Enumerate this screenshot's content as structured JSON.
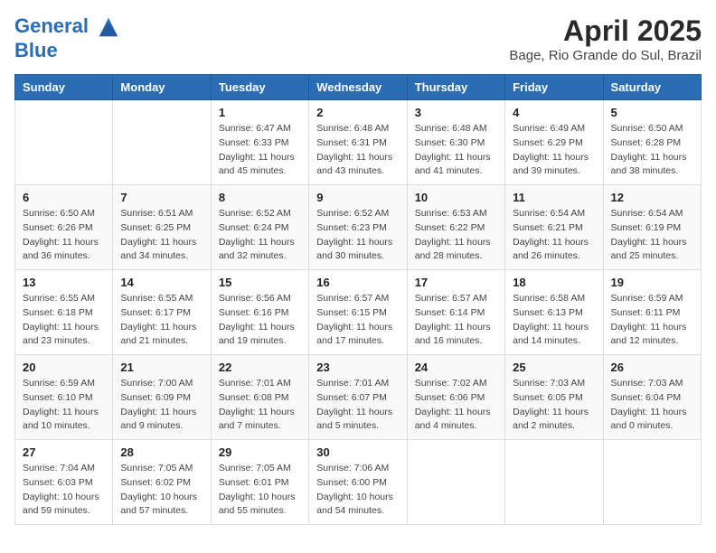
{
  "logo": {
    "line1": "General",
    "line2": "Blue"
  },
  "title": "April 2025",
  "subtitle": "Bage, Rio Grande do Sul, Brazil",
  "days_of_week": [
    "Sunday",
    "Monday",
    "Tuesday",
    "Wednesday",
    "Thursday",
    "Friday",
    "Saturday"
  ],
  "weeks": [
    [
      {
        "day": "",
        "info": ""
      },
      {
        "day": "",
        "info": ""
      },
      {
        "day": "1",
        "sunrise": "6:47 AM",
        "sunset": "6:33 PM",
        "daylight": "11 hours and 45 minutes."
      },
      {
        "day": "2",
        "sunrise": "6:48 AM",
        "sunset": "6:31 PM",
        "daylight": "11 hours and 43 minutes."
      },
      {
        "day": "3",
        "sunrise": "6:48 AM",
        "sunset": "6:30 PM",
        "daylight": "11 hours and 41 minutes."
      },
      {
        "day": "4",
        "sunrise": "6:49 AM",
        "sunset": "6:29 PM",
        "daylight": "11 hours and 39 minutes."
      },
      {
        "day": "5",
        "sunrise": "6:50 AM",
        "sunset": "6:28 PM",
        "daylight": "11 hours and 38 minutes."
      }
    ],
    [
      {
        "day": "6",
        "sunrise": "6:50 AM",
        "sunset": "6:26 PM",
        "daylight": "11 hours and 36 minutes."
      },
      {
        "day": "7",
        "sunrise": "6:51 AM",
        "sunset": "6:25 PM",
        "daylight": "11 hours and 34 minutes."
      },
      {
        "day": "8",
        "sunrise": "6:52 AM",
        "sunset": "6:24 PM",
        "daylight": "11 hours and 32 minutes."
      },
      {
        "day": "9",
        "sunrise": "6:52 AM",
        "sunset": "6:23 PM",
        "daylight": "11 hours and 30 minutes."
      },
      {
        "day": "10",
        "sunrise": "6:53 AM",
        "sunset": "6:22 PM",
        "daylight": "11 hours and 28 minutes."
      },
      {
        "day": "11",
        "sunrise": "6:54 AM",
        "sunset": "6:21 PM",
        "daylight": "11 hours and 26 minutes."
      },
      {
        "day": "12",
        "sunrise": "6:54 AM",
        "sunset": "6:19 PM",
        "daylight": "11 hours and 25 minutes."
      }
    ],
    [
      {
        "day": "13",
        "sunrise": "6:55 AM",
        "sunset": "6:18 PM",
        "daylight": "11 hours and 23 minutes."
      },
      {
        "day": "14",
        "sunrise": "6:55 AM",
        "sunset": "6:17 PM",
        "daylight": "11 hours and 21 minutes."
      },
      {
        "day": "15",
        "sunrise": "6:56 AM",
        "sunset": "6:16 PM",
        "daylight": "11 hours and 19 minutes."
      },
      {
        "day": "16",
        "sunrise": "6:57 AM",
        "sunset": "6:15 PM",
        "daylight": "11 hours and 17 minutes."
      },
      {
        "day": "17",
        "sunrise": "6:57 AM",
        "sunset": "6:14 PM",
        "daylight": "11 hours and 16 minutes."
      },
      {
        "day": "18",
        "sunrise": "6:58 AM",
        "sunset": "6:13 PM",
        "daylight": "11 hours and 14 minutes."
      },
      {
        "day": "19",
        "sunrise": "6:59 AM",
        "sunset": "6:11 PM",
        "daylight": "11 hours and 12 minutes."
      }
    ],
    [
      {
        "day": "20",
        "sunrise": "6:59 AM",
        "sunset": "6:10 PM",
        "daylight": "11 hours and 10 minutes."
      },
      {
        "day": "21",
        "sunrise": "7:00 AM",
        "sunset": "6:09 PM",
        "daylight": "11 hours and 9 minutes."
      },
      {
        "day": "22",
        "sunrise": "7:01 AM",
        "sunset": "6:08 PM",
        "daylight": "11 hours and 7 minutes."
      },
      {
        "day": "23",
        "sunrise": "7:01 AM",
        "sunset": "6:07 PM",
        "daylight": "11 hours and 5 minutes."
      },
      {
        "day": "24",
        "sunrise": "7:02 AM",
        "sunset": "6:06 PM",
        "daylight": "11 hours and 4 minutes."
      },
      {
        "day": "25",
        "sunrise": "7:03 AM",
        "sunset": "6:05 PM",
        "daylight": "11 hours and 2 minutes."
      },
      {
        "day": "26",
        "sunrise": "7:03 AM",
        "sunset": "6:04 PM",
        "daylight": "11 hours and 0 minutes."
      }
    ],
    [
      {
        "day": "27",
        "sunrise": "7:04 AM",
        "sunset": "6:03 PM",
        "daylight": "10 hours and 59 minutes."
      },
      {
        "day": "28",
        "sunrise": "7:05 AM",
        "sunset": "6:02 PM",
        "daylight": "10 hours and 57 minutes."
      },
      {
        "day": "29",
        "sunrise": "7:05 AM",
        "sunset": "6:01 PM",
        "daylight": "10 hours and 55 minutes."
      },
      {
        "day": "30",
        "sunrise": "7:06 AM",
        "sunset": "6:00 PM",
        "daylight": "10 hours and 54 minutes."
      },
      {
        "day": "",
        "info": ""
      },
      {
        "day": "",
        "info": ""
      },
      {
        "day": "",
        "info": ""
      }
    ]
  ]
}
